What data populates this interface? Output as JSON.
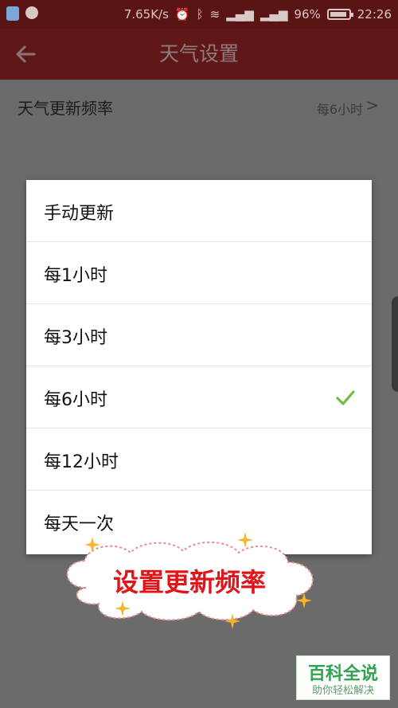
{
  "status_bar": {
    "speed": "7.65K/s",
    "battery_percent": "96%",
    "time": "22:26"
  },
  "app_bar": {
    "title": "天气设置"
  },
  "settings": {
    "update_frequency_label": "天气更新频率",
    "update_frequency_value": "每6小时",
    "chevron": ">"
  },
  "dialog": {
    "options": [
      {
        "label": "手动更新",
        "selected": false
      },
      {
        "label": "每1小时",
        "selected": false
      },
      {
        "label": "每3小时",
        "selected": false
      },
      {
        "label": "每6小时",
        "selected": true
      },
      {
        "label": "每12小时",
        "selected": false
      },
      {
        "label": "每天一次",
        "selected": false
      }
    ]
  },
  "annotation": {
    "text": "设置更新频率"
  },
  "watermark": {
    "main": "百科全说",
    "sub": "助你轻松解决"
  },
  "colors": {
    "status_bar_bg": "#5a1414",
    "app_bar_bg": "#5f1717",
    "check_green": "#6fbf45",
    "annotation_red": "#e0151a"
  }
}
